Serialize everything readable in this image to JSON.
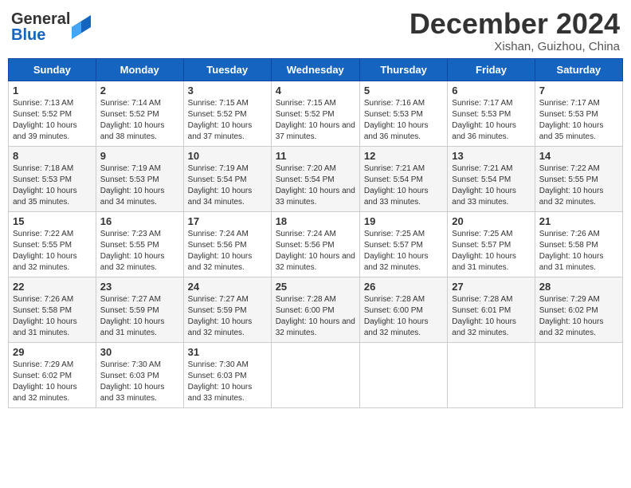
{
  "header": {
    "logo_general": "General",
    "logo_blue": "Blue",
    "title": "December 2024",
    "location": "Xishan, Guizhou, China"
  },
  "days_of_week": [
    "Sunday",
    "Monday",
    "Tuesday",
    "Wednesday",
    "Thursday",
    "Friday",
    "Saturday"
  ],
  "weeks": [
    [
      {
        "day": "1",
        "sunrise": "7:13 AM",
        "sunset": "5:52 PM",
        "daylight": "10 hours and 39 minutes."
      },
      {
        "day": "2",
        "sunrise": "7:14 AM",
        "sunset": "5:52 PM",
        "daylight": "10 hours and 38 minutes."
      },
      {
        "day": "3",
        "sunrise": "7:15 AM",
        "sunset": "5:52 PM",
        "daylight": "10 hours and 37 minutes."
      },
      {
        "day": "4",
        "sunrise": "7:15 AM",
        "sunset": "5:52 PM",
        "daylight": "10 hours and 37 minutes."
      },
      {
        "day": "5",
        "sunrise": "7:16 AM",
        "sunset": "5:53 PM",
        "daylight": "10 hours and 36 minutes."
      },
      {
        "day": "6",
        "sunrise": "7:17 AM",
        "sunset": "5:53 PM",
        "daylight": "10 hours and 36 minutes."
      },
      {
        "day": "7",
        "sunrise": "7:17 AM",
        "sunset": "5:53 PM",
        "daylight": "10 hours and 35 minutes."
      }
    ],
    [
      {
        "day": "8",
        "sunrise": "7:18 AM",
        "sunset": "5:53 PM",
        "daylight": "10 hours and 35 minutes."
      },
      {
        "day": "9",
        "sunrise": "7:19 AM",
        "sunset": "5:53 PM",
        "daylight": "10 hours and 34 minutes."
      },
      {
        "day": "10",
        "sunrise": "7:19 AM",
        "sunset": "5:54 PM",
        "daylight": "10 hours and 34 minutes."
      },
      {
        "day": "11",
        "sunrise": "7:20 AM",
        "sunset": "5:54 PM",
        "daylight": "10 hours and 33 minutes."
      },
      {
        "day": "12",
        "sunrise": "7:21 AM",
        "sunset": "5:54 PM",
        "daylight": "10 hours and 33 minutes."
      },
      {
        "day": "13",
        "sunrise": "7:21 AM",
        "sunset": "5:54 PM",
        "daylight": "10 hours and 33 minutes."
      },
      {
        "day": "14",
        "sunrise": "7:22 AM",
        "sunset": "5:55 PM",
        "daylight": "10 hours and 32 minutes."
      }
    ],
    [
      {
        "day": "15",
        "sunrise": "7:22 AM",
        "sunset": "5:55 PM",
        "daylight": "10 hours and 32 minutes."
      },
      {
        "day": "16",
        "sunrise": "7:23 AM",
        "sunset": "5:55 PM",
        "daylight": "10 hours and 32 minutes."
      },
      {
        "day": "17",
        "sunrise": "7:24 AM",
        "sunset": "5:56 PM",
        "daylight": "10 hours and 32 minutes."
      },
      {
        "day": "18",
        "sunrise": "7:24 AM",
        "sunset": "5:56 PM",
        "daylight": "10 hours and 32 minutes."
      },
      {
        "day": "19",
        "sunrise": "7:25 AM",
        "sunset": "5:57 PM",
        "daylight": "10 hours and 32 minutes."
      },
      {
        "day": "20",
        "sunrise": "7:25 AM",
        "sunset": "5:57 PM",
        "daylight": "10 hours and 31 minutes."
      },
      {
        "day": "21",
        "sunrise": "7:26 AM",
        "sunset": "5:58 PM",
        "daylight": "10 hours and 31 minutes."
      }
    ],
    [
      {
        "day": "22",
        "sunrise": "7:26 AM",
        "sunset": "5:58 PM",
        "daylight": "10 hours and 31 minutes."
      },
      {
        "day": "23",
        "sunrise": "7:27 AM",
        "sunset": "5:59 PM",
        "daylight": "10 hours and 31 minutes."
      },
      {
        "day": "24",
        "sunrise": "7:27 AM",
        "sunset": "5:59 PM",
        "daylight": "10 hours and 32 minutes."
      },
      {
        "day": "25",
        "sunrise": "7:28 AM",
        "sunset": "6:00 PM",
        "daylight": "10 hours and 32 minutes."
      },
      {
        "day": "26",
        "sunrise": "7:28 AM",
        "sunset": "6:00 PM",
        "daylight": "10 hours and 32 minutes."
      },
      {
        "day": "27",
        "sunrise": "7:28 AM",
        "sunset": "6:01 PM",
        "daylight": "10 hours and 32 minutes."
      },
      {
        "day": "28",
        "sunrise": "7:29 AM",
        "sunset": "6:02 PM",
        "daylight": "10 hours and 32 minutes."
      }
    ],
    [
      {
        "day": "29",
        "sunrise": "7:29 AM",
        "sunset": "6:02 PM",
        "daylight": "10 hours and 32 minutes."
      },
      {
        "day": "30",
        "sunrise": "7:30 AM",
        "sunset": "6:03 PM",
        "daylight": "10 hours and 33 minutes."
      },
      {
        "day": "31",
        "sunrise": "7:30 AM",
        "sunset": "6:03 PM",
        "daylight": "10 hours and 33 minutes."
      },
      null,
      null,
      null,
      null
    ]
  ]
}
